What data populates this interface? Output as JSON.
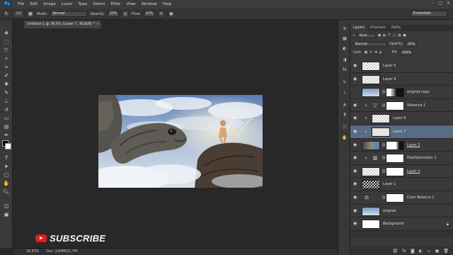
{
  "app": {
    "logo": "Ps",
    "menu": [
      "File",
      "Edit",
      "Image",
      "Layer",
      "Type",
      "Select",
      "Filter",
      "View",
      "Window",
      "Help"
    ],
    "window_controls": [
      "–",
      "□",
      "✕"
    ]
  },
  "options_bar": {
    "brush_size": "125",
    "mode_label": "Mode:",
    "mode_value": "Normal",
    "opacity_label": "Opacity:",
    "opacity_value": "20%",
    "flow_label": "Flow:",
    "flow_value": "53%",
    "workspace": "Essentials"
  },
  "document": {
    "tab_title": "Untitled-1 @ 38,6% (Layer 7, RGB/8) *",
    "close": "×"
  },
  "status_bar": {
    "zoom": "38,63%",
    "doc_info": "Doc: 2,64M/21,7M"
  },
  "overlay": {
    "subscribe_text": "SUBSCRIBE"
  },
  "colors": {
    "background": "#282828",
    "panel": "#3a3a3a",
    "selection": "#5a6b85",
    "youtube_red": "#e21b1b"
  },
  "layers_panel": {
    "tabs": [
      "Layers",
      "Channels",
      "Paths"
    ],
    "filter_kind": "Kind",
    "blend_mode": "Normal",
    "opacity_label": "Opacity:",
    "opacity_value": "35%",
    "lock_label": "Lock:",
    "fill_label": "Fill:",
    "fill_value": "100%",
    "layers": [
      {
        "name": "Layer 5",
        "thumb": "checker",
        "visible": true
      },
      {
        "name": "Layer 4",
        "thumb": "checker",
        "visible": true
      },
      {
        "name": "original copy",
        "thumb": "image",
        "mask": "dark",
        "visible": false
      },
      {
        "name": "Vibrance 1",
        "thumb": "adjust-vibrance",
        "mask": "white",
        "visible": true,
        "clipped": true
      },
      {
        "name": "Layer 6",
        "thumb": "checker",
        "visible": true,
        "clipped": true
      },
      {
        "name": "Layer 7",
        "thumb": "checker",
        "visible": true,
        "clipped": true,
        "selected": true
      },
      {
        "name": "Layer 3",
        "thumb": "image",
        "mask": "dark",
        "visible": true,
        "underlined": true
      },
      {
        "name": "Hue/Saturation 1",
        "thumb": "adjust-hue",
        "mask": "white",
        "visible": true,
        "clipped": true
      },
      {
        "name": "Layer 2",
        "thumb": "checker",
        "mask": "white",
        "visible": true,
        "underlined": true
      },
      {
        "name": "Layer 1",
        "thumb": "checker-dark",
        "visible": true
      },
      {
        "name": "Color Balance 1",
        "thumb": "adjust-balance",
        "mask": "white",
        "visible": true
      },
      {
        "name": "original",
        "thumb": "image",
        "visible": true
      },
      {
        "name": "Background",
        "thumb": "white",
        "visible": true,
        "italic": true,
        "locked": true
      }
    ]
  }
}
